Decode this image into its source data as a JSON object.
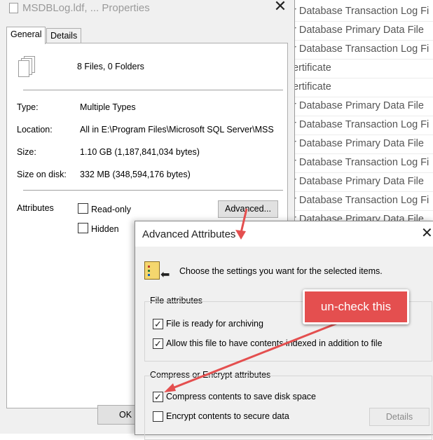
{
  "background_list": {
    "rows": [
      "r Database Transaction Log Fi",
      "r Database Primary Data File",
      "r Database Transaction Log Fi",
      "ertificate",
      "ertificate",
      "r Database Primary Data File",
      "r Database Transaction Log Fi",
      "r Database Primary Data File",
      "r Database Transaction Log Fi",
      "r Database Primary Data File",
      "r Database Transaction Log Fi",
      "r Database Primary Data File"
    ]
  },
  "properties": {
    "title": "MSDBLog.ldf, ... Properties",
    "close_glyph": "✕",
    "tabs": [
      "General",
      "Details"
    ],
    "file_count": "8 Files, 0 Folders",
    "fields": [
      {
        "label": "Type:",
        "value": "Multiple Types"
      },
      {
        "label": "Location:",
        "value": "All in E:\\Program Files\\Microsoft SQL Server\\MSS"
      },
      {
        "label": "Size:",
        "value": "1.10 GB (1,187,841,034 bytes)"
      },
      {
        "label": "Size on disk:",
        "value": "332 MB (348,594,176 bytes)"
      }
    ],
    "attributes_label": "Attributes",
    "readonly_label": "Read-only",
    "hidden_label": "Hidden",
    "advanced_button": "Advanced...",
    "ok_button": "OK"
  },
  "advanced": {
    "title": "Advanced Attributes",
    "close_glyph": "✕",
    "intro": "Choose the settings you want for the selected items.",
    "file_attributes_label": "File attributes",
    "archive_label": "File is ready for archiving",
    "index_label": "Allow this file to have contents indexed in addition to file",
    "compress_group_label": "Compress or Encrypt attributes",
    "compress_label": "Compress contents to save disk space",
    "encrypt_label": "Encrypt contents to secure data",
    "details_button": "Details",
    "check_glyph": "✓"
  },
  "annotation": {
    "callout_text": "un-check this",
    "arrow_color": "#e44f4f"
  }
}
